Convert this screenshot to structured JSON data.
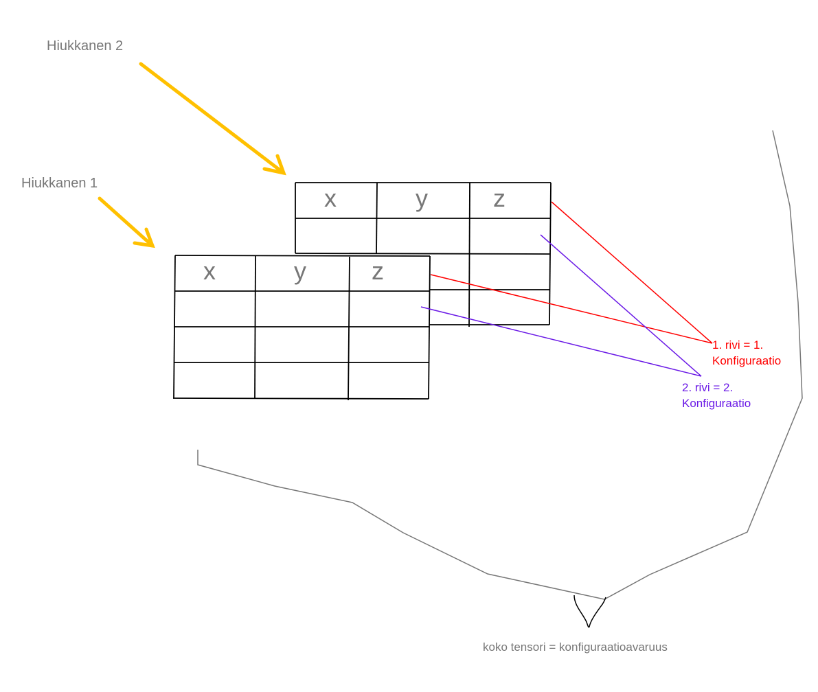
{
  "labels": {
    "particle2": "Hiukkanen 2",
    "particle1": "Hiukkanen 1",
    "row1_line1": "1. rivi = 1.",
    "row1_line2": "Konfiguraatio",
    "row2_line1": "2. rivi = 2.",
    "row2_line2": "Konfiguraatio",
    "whole_tensor": "koko tensori = konfiguraatioavaruus"
  },
  "table_back": {
    "headers": [
      "x",
      "y",
      "z"
    ]
  },
  "table_front": {
    "headers": [
      "x",
      "y",
      "z"
    ]
  },
  "colors": {
    "arrow": "#ffc000",
    "row1": "#ff0000",
    "row2": "#6a19e6",
    "annotation_text": "#777777",
    "grid": "#000000",
    "brace": "#777777"
  }
}
